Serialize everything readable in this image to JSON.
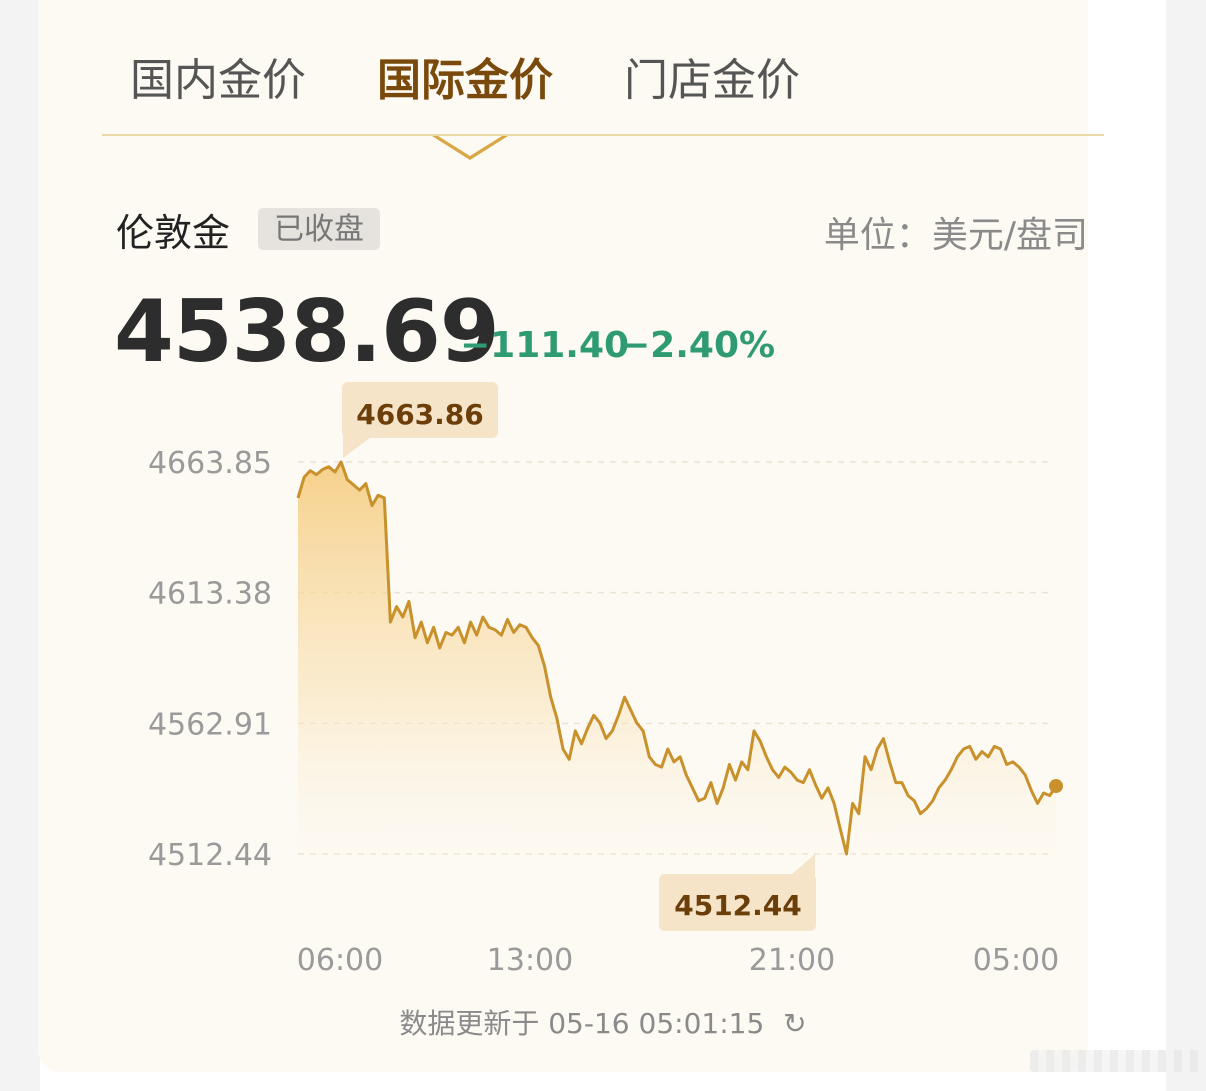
{
  "tabs": [
    {
      "label": "国内金价",
      "active": false
    },
    {
      "label": "国际金价",
      "active": true
    },
    {
      "label": "门店金价",
      "active": false
    }
  ],
  "instrument": {
    "name": "伦敦金",
    "status_badge": "已收盘",
    "unit": "单位：美元/盘司"
  },
  "quote": {
    "price": "4538.69",
    "change": "−111.40",
    "change_pct": "−2.40%"
  },
  "footer": {
    "update_text": "数据更新于 05-16 05:01:15",
    "refresh_icon": "refresh-icon"
  },
  "colors": {
    "accent": "#c8912c",
    "down": "#2e9b72",
    "active_tab": "#7a4a0c",
    "callout_bg": "#f5e4c8"
  },
  "chart_data": {
    "type": "area",
    "title": "",
    "xlabel": "",
    "ylabel": "",
    "y_ticks": [
      "4663.85",
      "4613.38",
      "4562.91",
      "4512.44"
    ],
    "x_ticks": [
      "06:00",
      "13:00",
      "21:00",
      "05:00"
    ],
    "ylim": [
      4512.44,
      4663.85
    ],
    "grid": true,
    "max_label": "4663.86",
    "min_label": "4512.44",
    "series": [
      {
        "values": [
          4650.0,
          4658.0,
          4660.5,
          4659.0,
          4661.0,
          4662.0,
          4660.0,
          4663.86,
          4657.0,
          4655.0,
          4653.0,
          4655.5,
          4647.0,
          4651.0,
          4650.0,
          4602.0,
          4608.0,
          4604.0,
          4610.0,
          4596.0,
          4602.0,
          4594.0,
          4600.0,
          4592.0,
          4598.0,
          4597.0,
          4600.0,
          4594.0,
          4602.0,
          4597.0,
          4604.0,
          4600.0,
          4599.0,
          4597.0,
          4603.0,
          4598.0,
          4601.0,
          4600.0,
          4596.0,
          4593.0,
          4585.0,
          4573.0,
          4565.0,
          4553.0,
          4549.0,
          4560.0,
          4555.0,
          4561.0,
          4566.0,
          4563.0,
          4557.0,
          4560.0,
          4566.0,
          4573.0,
          4568.0,
          4563.0,
          4560.0,
          4550.0,
          4547.0,
          4546.0,
          4553.0,
          4548.0,
          4550.0,
          4543.0,
          4538.0,
          4533.0,
          4534.0,
          4540.0,
          4532.0,
          4538.0,
          4547.0,
          4541.0,
          4548.0,
          4545.0,
          4560.0,
          4556.0,
          4550.0,
          4545.0,
          4542.0,
          4546.0,
          4544.0,
          4541.0,
          4540.0,
          4545.0,
          4539.0,
          4534.0,
          4538.0,
          4532.0,
          4522.0,
          4512.44,
          4532.0,
          4528.0,
          4550.0,
          4545.0,
          4553.0,
          4557.0,
          4548.0,
          4540.0,
          4540.0,
          4535.0,
          4533.0,
          4528.0,
          4530.0,
          4533.0,
          4538.0,
          4541.0,
          4545.0,
          4550.0,
          4553.0,
          4554.0,
          4549.0,
          4552.0,
          4550.0,
          4554.0,
          4553.0,
          4547.0,
          4548.0,
          4546.0,
          4543.0,
          4537.0,
          4532.0,
          4536.0,
          4535.0,
          4538.69
        ]
      }
    ]
  }
}
